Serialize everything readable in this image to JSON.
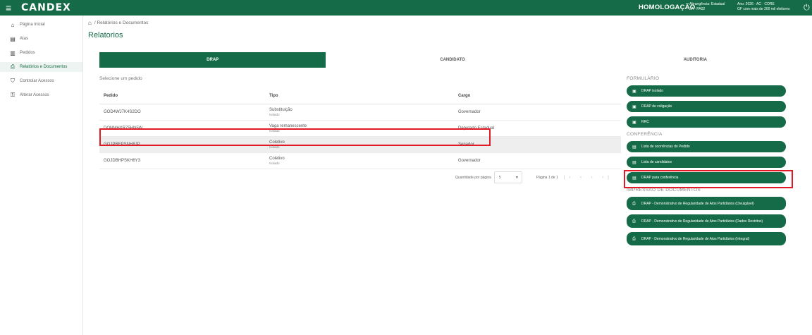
{
  "topbar": {
    "menu_icon": "menu-icon",
    "logo": "CANDEX",
    "environment": "HOMOLOGAÇÃO",
    "election_line1": "Abrangência: Estadual",
    "election_line2": "2A - PA02",
    "election_line3": "Ano: 2026 · AC · CORE",
    "election_line4": "GF com mais de 200 mil eleitores",
    "power_icon": "power-icon"
  },
  "sidebar": {
    "items": [
      {
        "icon": "home-icon",
        "label": "Página Inicial"
      },
      {
        "icon": "atas-icon",
        "label": "Atas"
      },
      {
        "icon": "pedidos-icon",
        "label": "Pedidos"
      },
      {
        "icon": "print-icon",
        "label": "Relatórios e Documentos"
      },
      {
        "icon": "access-icon",
        "label": "Controlar Acessos"
      },
      {
        "icon": "key-icon",
        "label": "Alterar Acessos"
      }
    ]
  },
  "breadcrumb": {
    "home_icon": "home-icon",
    "text": "/ Relatórios e Documentos"
  },
  "page_title": "Relatorios",
  "tabs": [
    "DRAP",
    "CANDIDATO",
    "AUDITORIA"
  ],
  "table": {
    "caption": "Selecione um pedido",
    "headers": [
      "Pedido",
      "Tipo",
      "Cargo"
    ],
    "rows": [
      {
        "pedido": "GOD4WJ7K4S2DO",
        "tipo": "Substituição",
        "sub": "Isolado",
        "cargo": "Governador"
      },
      {
        "pedido": "DONMHXR75HN5W",
        "tipo": "Vaga remanescente",
        "sub": "Isolado",
        "cargo": "Deputado Estadual"
      },
      {
        "pedido": "GOJPREPSNH8JP",
        "tipo": "Coletivo",
        "sub": "Isolado",
        "cargo": "Senador"
      },
      {
        "pedido": "GOJDBHPSKH6Y3",
        "tipo": "Coletivo",
        "sub": "Isolado",
        "cargo": "Governador"
      }
    ]
  },
  "pager": {
    "label": "Quantidade por página",
    "value": "5",
    "range": "Página 1 de 1"
  },
  "right": {
    "formulario_title": "FORMULÁRIO",
    "formulario": [
      "DRAP isolado",
      "DRAP de coligação",
      "RRC"
    ],
    "conferencia_title": "CONFERÊNCIA",
    "conferencia": [
      "Lista de ocorrências do Pedido",
      "Lista de candidatos",
      "DRAP para conferência"
    ],
    "impressao_title": "IMPRESSÃO DE DOCUMENTOS",
    "impressao": [
      "DRAP - Demonstrativo de Regularidade de Atos Partidários (Divulgável)",
      "DRAP - Demonstrativo de Regularidade de Atos Partidários (Dados Restritos)",
      "DRAP - Demonstrativo de Regularidade de Atos Partidários (Integral)"
    ]
  }
}
